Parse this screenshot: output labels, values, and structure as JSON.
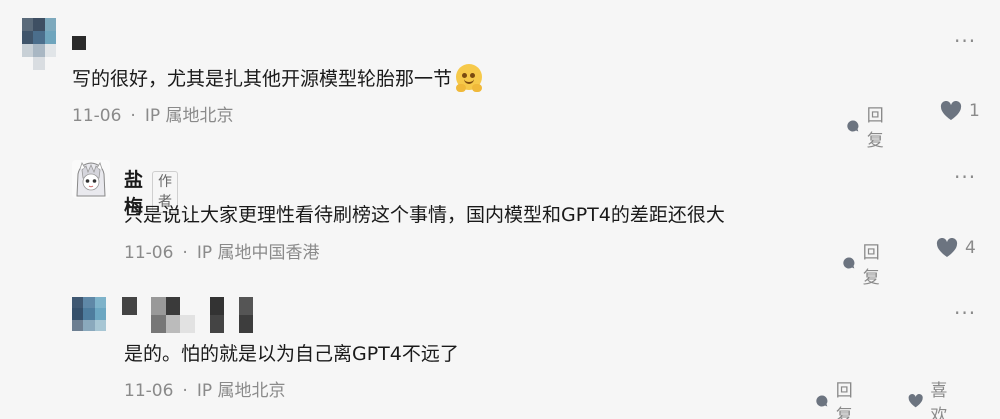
{
  "comments": [
    {
      "content": "写的很好，尤其是扎其他开源模型轮胎那一节",
      "emoji": "grinning-face-with-hands-emoji",
      "date": "11-06",
      "ip_location": "IP 属地北京",
      "reply_label": "回复",
      "like_count": "1"
    },
    {
      "username": "盐梅",
      "author_badge": "作者",
      "content": "只是说让大家更理性看待刷榜这个事情，国内模型和GPT4的差距还很大",
      "date": "11-06",
      "ip_location": "IP 属地中国香港",
      "reply_label": "回复",
      "like_count": "4"
    },
    {
      "content": "是的。怕的就是以为自己离GPT4不远了",
      "date": "11-06",
      "ip_location": "IP 属地北京",
      "reply_label": "回复",
      "like_label": "喜欢"
    }
  ],
  "meta_separator": "·",
  "more_label": "···",
  "colors": {
    "background": "#f6f6f6",
    "text": "#1a1a1a",
    "muted": "#8a8a8a"
  }
}
